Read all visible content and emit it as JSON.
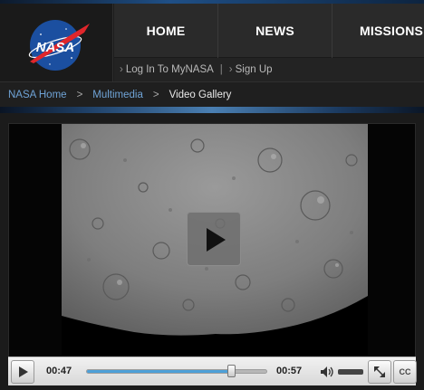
{
  "brand": {
    "logo_text": "NASA"
  },
  "nav": {
    "items": [
      {
        "label": "HOME"
      },
      {
        "label": "NEWS"
      },
      {
        "label": "MISSIONS"
      }
    ]
  },
  "subnav": {
    "login_label": "Log In To MyNASA",
    "separator": "|",
    "signup_label": "Sign Up",
    "chevron": "›"
  },
  "breadcrumb": {
    "items": [
      "NASA Home",
      "Multimedia"
    ],
    "current": "Video Gallery",
    "arrow": ">"
  },
  "player": {
    "elapsed": "00:47",
    "total": "00:57",
    "progress_fraction": 0.82,
    "cc_label": "CC"
  },
  "colors": {
    "link": "#6fa3d6",
    "progress": "#4da0d8",
    "nasa_blue": "#1b4fa0",
    "nasa_red": "#e0262b"
  },
  "icons": [
    "nasa-logo",
    "play-icon",
    "volume-icon",
    "expand-icon"
  ]
}
